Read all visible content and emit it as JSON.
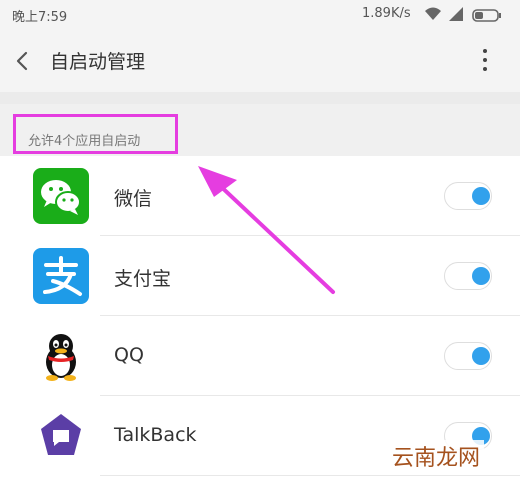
{
  "status_bar": {
    "time": "晚上7:59",
    "speed": "1.89K/s",
    "icons": [
      "wifi-icon",
      "signal-icon",
      "battery-icon"
    ]
  },
  "header": {
    "title": "自启动管理",
    "back_icon": "chevron-left-icon",
    "more_icon": "more-vertical-icon"
  },
  "section": {
    "label": "允许4个应用自启动"
  },
  "apps": [
    {
      "name": "微信",
      "icon": "wechat-icon",
      "enabled": true
    },
    {
      "name": "支付宝",
      "icon": "alipay-icon",
      "enabled": true
    },
    {
      "name": "QQ",
      "icon": "qq-icon",
      "enabled": true
    },
    {
      "name": "TalkBack",
      "icon": "talkback-icon",
      "enabled": true
    }
  ],
  "annotation": {
    "highlight_color": "#e53de0",
    "arrow_color": "#e53de0"
  },
  "watermark": {
    "text": "云南龙网"
  },
  "colors": {
    "toggle_on": "#32a1ec",
    "wechat_green": "#1aad19",
    "alipay_blue": "#1e9be8",
    "talkback_purple": "#5b3ea6"
  }
}
